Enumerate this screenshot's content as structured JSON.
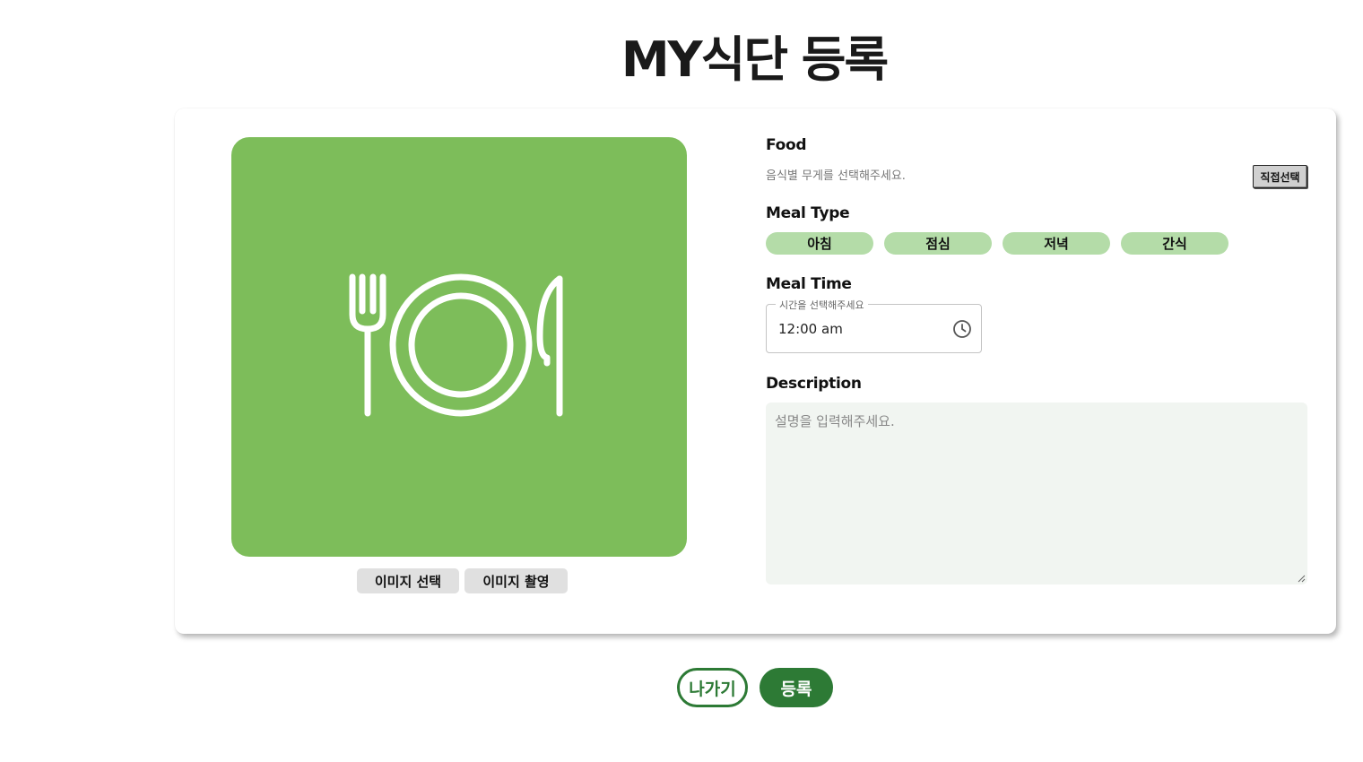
{
  "page": {
    "title": "MY식단 등록"
  },
  "image_panel": {
    "icon": "plate-fork-knife-icon",
    "bg_color": "#7dbd5a",
    "select_label": "이미지 선택",
    "capture_label": "이미지 촬영"
  },
  "food": {
    "label": "Food",
    "hint": "음식별 무게를 선택해주세요.",
    "direct_select_label": "직접선택"
  },
  "meal_type": {
    "label": "Meal Type",
    "options": [
      "아침",
      "점심",
      "저녁",
      "간식"
    ],
    "chip_color": "#b4dca8"
  },
  "meal_time": {
    "label": "Meal Time",
    "legend": "시간을 선택해주세요",
    "value": "12:00 am",
    "icon": "clock-icon"
  },
  "description": {
    "label": "Description",
    "placeholder": "설명을 입력해주세요."
  },
  "actions": {
    "exit_label": "나가기",
    "submit_label": "등록",
    "accent_color": "#2d7a35"
  }
}
